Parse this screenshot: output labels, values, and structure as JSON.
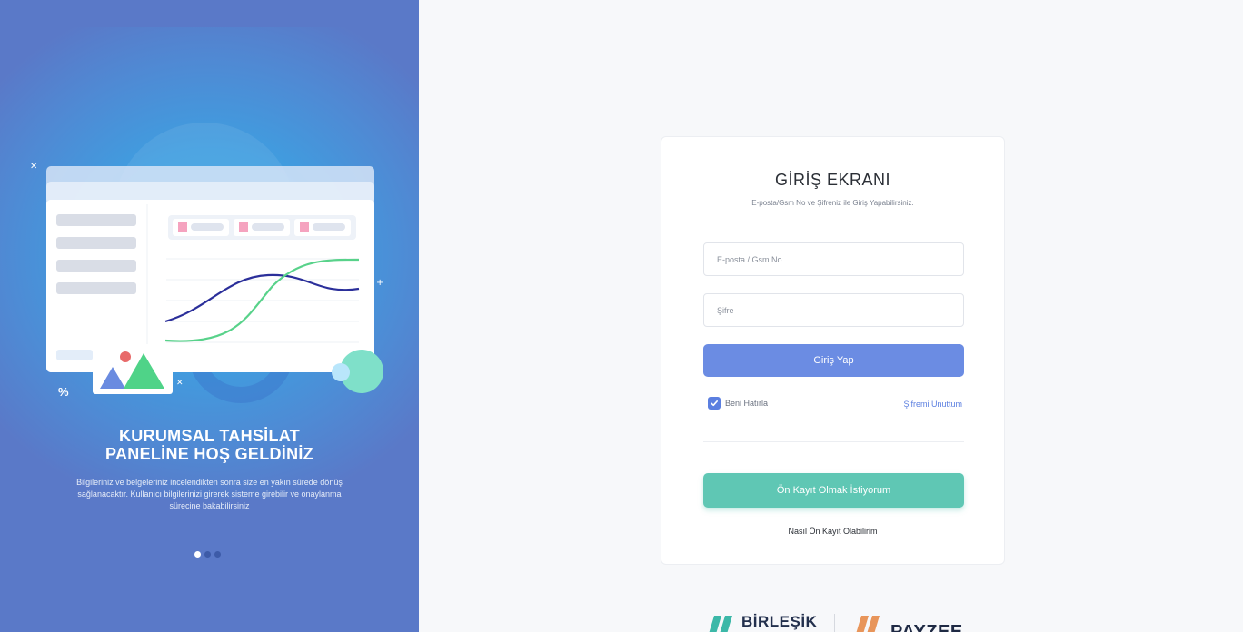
{
  "hero": {
    "title_line1": "KURUMSAL TAHSİLAT",
    "title_line2": "PANELİNE HOŞ GELDİNİZ",
    "description": "Bilgileriniz ve belgeleriniz incelendikten sonra size en yakın sürede dönüş sağlanacaktır. Kullanıcı bilgilerinizi girerek sisteme girebilir ve onaylanma sürecine bakabilirsiniz",
    "carousel": {
      "count": 3,
      "active_index": 0
    },
    "percent_glyph": "%"
  },
  "login": {
    "title": "GİRİŞ EKRANI",
    "subtitle": "E-posta/Gsm No ve Şifreniz ile Giriş Yapabilirsiniz.",
    "email_placeholder": "E-posta / Gsm No",
    "password_placeholder": "Şifre",
    "submit_label": "Giriş Yap",
    "remember_label": "Beni Hatırla",
    "remember_checked": true,
    "forgot_label": "Şifremi Unuttum",
    "register_label": "Ön Kayıt Olmak İstiyorum",
    "how_label": "Nasıl Ön Kayıt Olabilirim"
  },
  "footer": {
    "logo1_text": "BİRLEŞİK",
    "logo2_text": "PAYZEE"
  },
  "colors": {
    "left_panel": "#5a79c8",
    "login_button": "#6b8ce3",
    "register_button": "#5fc7b4",
    "link": "#5b7fe0"
  }
}
